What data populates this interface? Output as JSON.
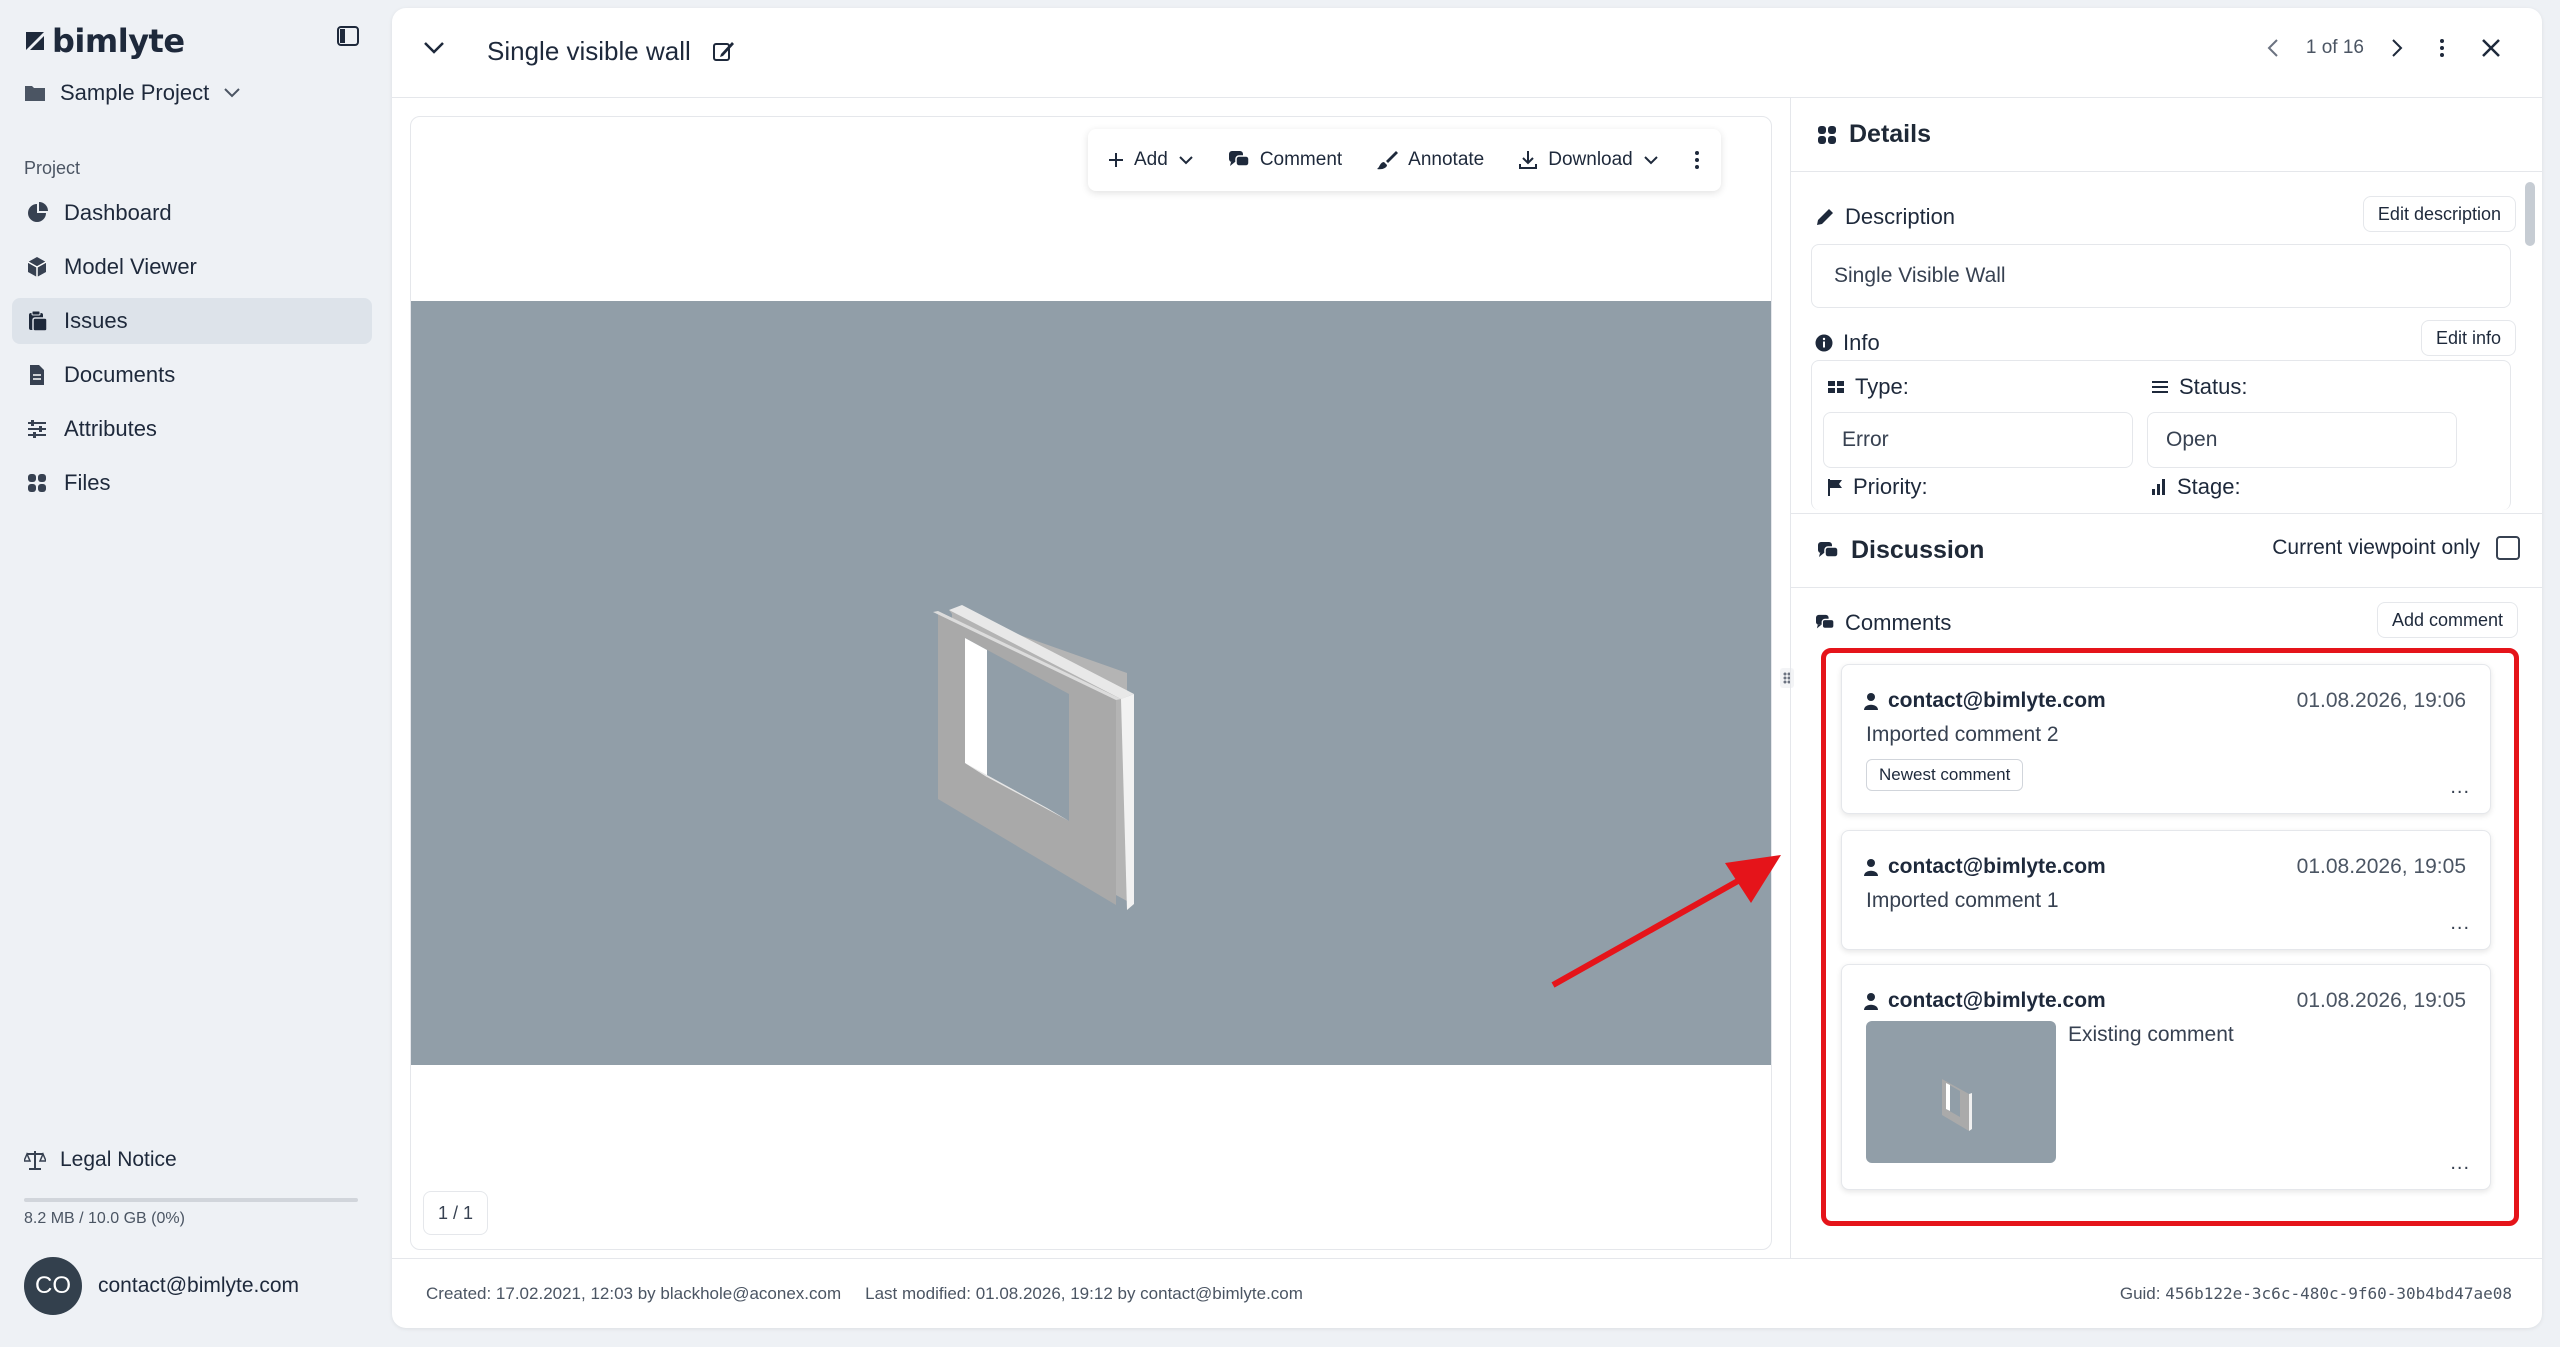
{
  "app": {
    "logo_text": "bimlyte"
  },
  "sidebar": {
    "project_name": "Sample Project",
    "section_label": "Project",
    "items": [
      {
        "label": "Dashboard",
        "icon": "dashboard-icon"
      },
      {
        "label": "Model Viewer",
        "icon": "cube-icon"
      },
      {
        "label": "Issues",
        "icon": "clipboard-icon",
        "active": true
      },
      {
        "label": "Documents",
        "icon": "document-icon"
      },
      {
        "label": "Attributes",
        "icon": "sliders-icon"
      },
      {
        "label": "Files",
        "icon": "grid-icon"
      }
    ],
    "legal_notice": "Legal Notice",
    "storage": "8.2 MB / 10.0 GB (0%)",
    "user_initials": "CO",
    "user_email": "contact@bimlyte.com"
  },
  "header": {
    "title": "Single visible wall",
    "pager": "1 of 16"
  },
  "toolbar": {
    "add": "Add",
    "comment": "Comment",
    "annotate": "Annotate",
    "download": "Download"
  },
  "viewer": {
    "page_indicator": "1 / 1"
  },
  "details": {
    "heading": "Details",
    "description_label": "Description",
    "edit_description": "Edit description",
    "description_value": "Single Visible Wall",
    "info_label": "Info",
    "edit_info": "Edit info",
    "type_label": "Type:",
    "type_value": "Error",
    "status_label": "Status:",
    "status_value": "Open",
    "priority_label": "Priority:",
    "stage_label": "Stage:"
  },
  "discussion": {
    "heading": "Discussion",
    "viewpoint_only": "Current viewpoint only",
    "comments_label": "Comments",
    "add_comment": "Add comment",
    "comments": [
      {
        "author": "contact@bimlyte.com",
        "date": "01.08.2026, 19:06",
        "text": "Imported comment 2",
        "tag": "Newest comment"
      },
      {
        "author": "contact@bimlyte.com",
        "date": "01.08.2026, 19:05",
        "text": "Imported comment 1"
      },
      {
        "author": "contact@bimlyte.com",
        "date": "01.08.2026, 19:05",
        "text": "Existing comment"
      }
    ],
    "more": "..."
  },
  "footer": {
    "created": "Created: 17.02.2021, 12:03 by blackhole@aconex.com",
    "modified": "Last modified: 01.08.2026, 19:12 by contact@bimlyte.com",
    "guid_label": "Guid:",
    "guid_value": "456b122e-3c6c-480c-9f60-30b4bd47ae08"
  },
  "colors": {
    "highlight": "#e5141a",
    "scene": "#919ea8",
    "active_nav": "#dde3ea"
  }
}
